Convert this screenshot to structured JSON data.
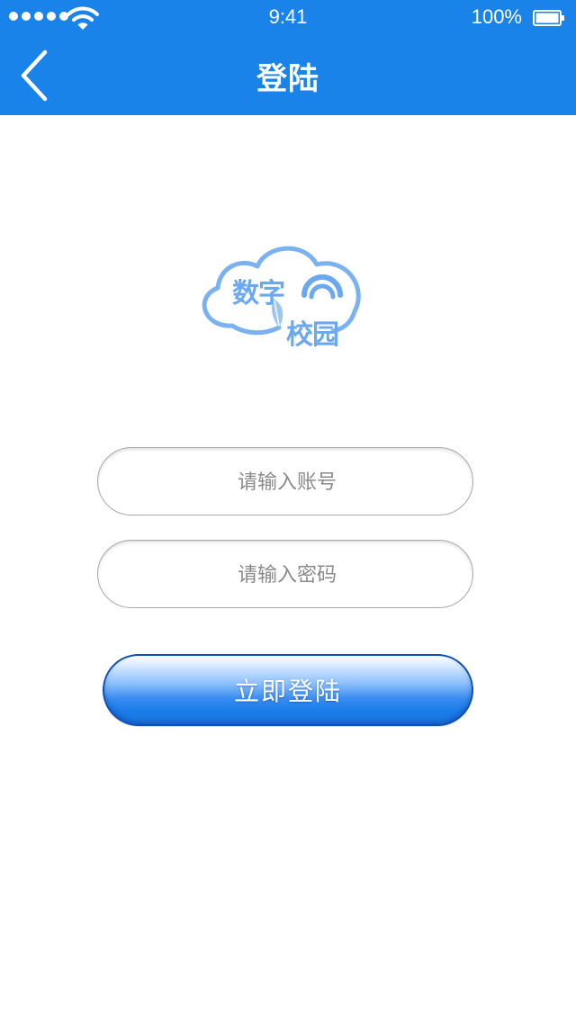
{
  "status_bar": {
    "time": "9:41",
    "battery_percent": "100%",
    "signal_icon": "signal-dots-icon",
    "wifi_icon": "wifi-icon",
    "battery_icon": "battery-icon"
  },
  "nav": {
    "title": "登陆",
    "back_icon": "chevron-left-icon"
  },
  "logo": {
    "line1": "数字",
    "line2": "校园",
    "icon": "cloud-logo-icon"
  },
  "form": {
    "account_placeholder": "请输入账号",
    "account_value": "",
    "password_placeholder": "请输入密码",
    "password_value": "",
    "submit_label": "立即登陆"
  },
  "colors": {
    "primary": "#1a83ea",
    "logo": "#6aa9f0",
    "field_border": "#a9a9a9",
    "placeholder": "#8a8a8a"
  }
}
